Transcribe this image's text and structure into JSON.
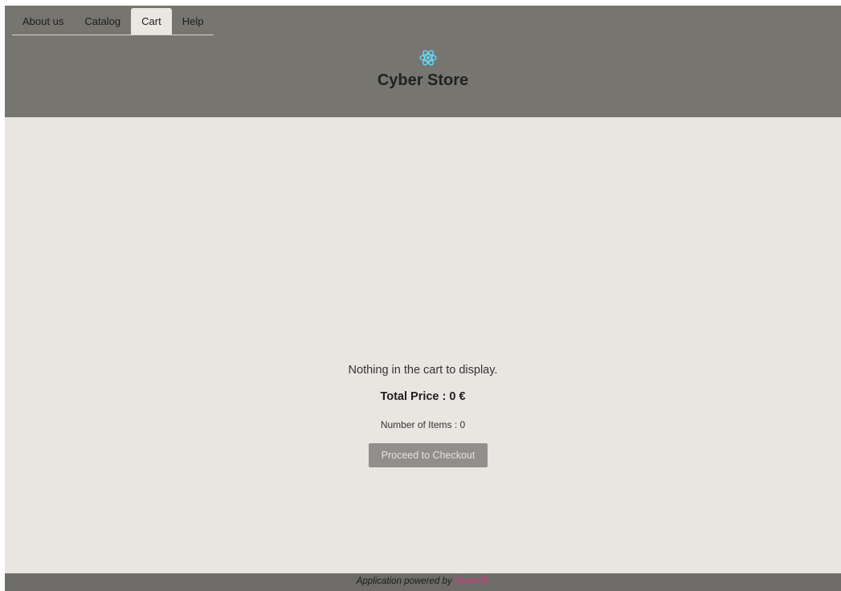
{
  "nav": {
    "tabs": [
      {
        "label": "About us",
        "active": false
      },
      {
        "label": "Catalog",
        "active": false
      },
      {
        "label": "Cart",
        "active": true
      },
      {
        "label": "Help",
        "active": false
      }
    ]
  },
  "header": {
    "logo_icon": "react-atom-icon",
    "title": "Cyber Store"
  },
  "cart": {
    "empty_message": "Nothing in the cart to display.",
    "total_price": "Total Price : 0 €",
    "item_count": "Number of Items : 0",
    "checkout_label": "Proceed to Checkout"
  },
  "footer": {
    "text": "Application powered by ",
    "link_label": "ReactJS"
  },
  "colors": {
    "header_bg": "#767570",
    "page_bg": "#e9e6e1",
    "footer_bg": "#6d6c68",
    "accent_link": "#d63b7d",
    "logo": "#61dafb",
    "button_bg": "#918f8b"
  }
}
